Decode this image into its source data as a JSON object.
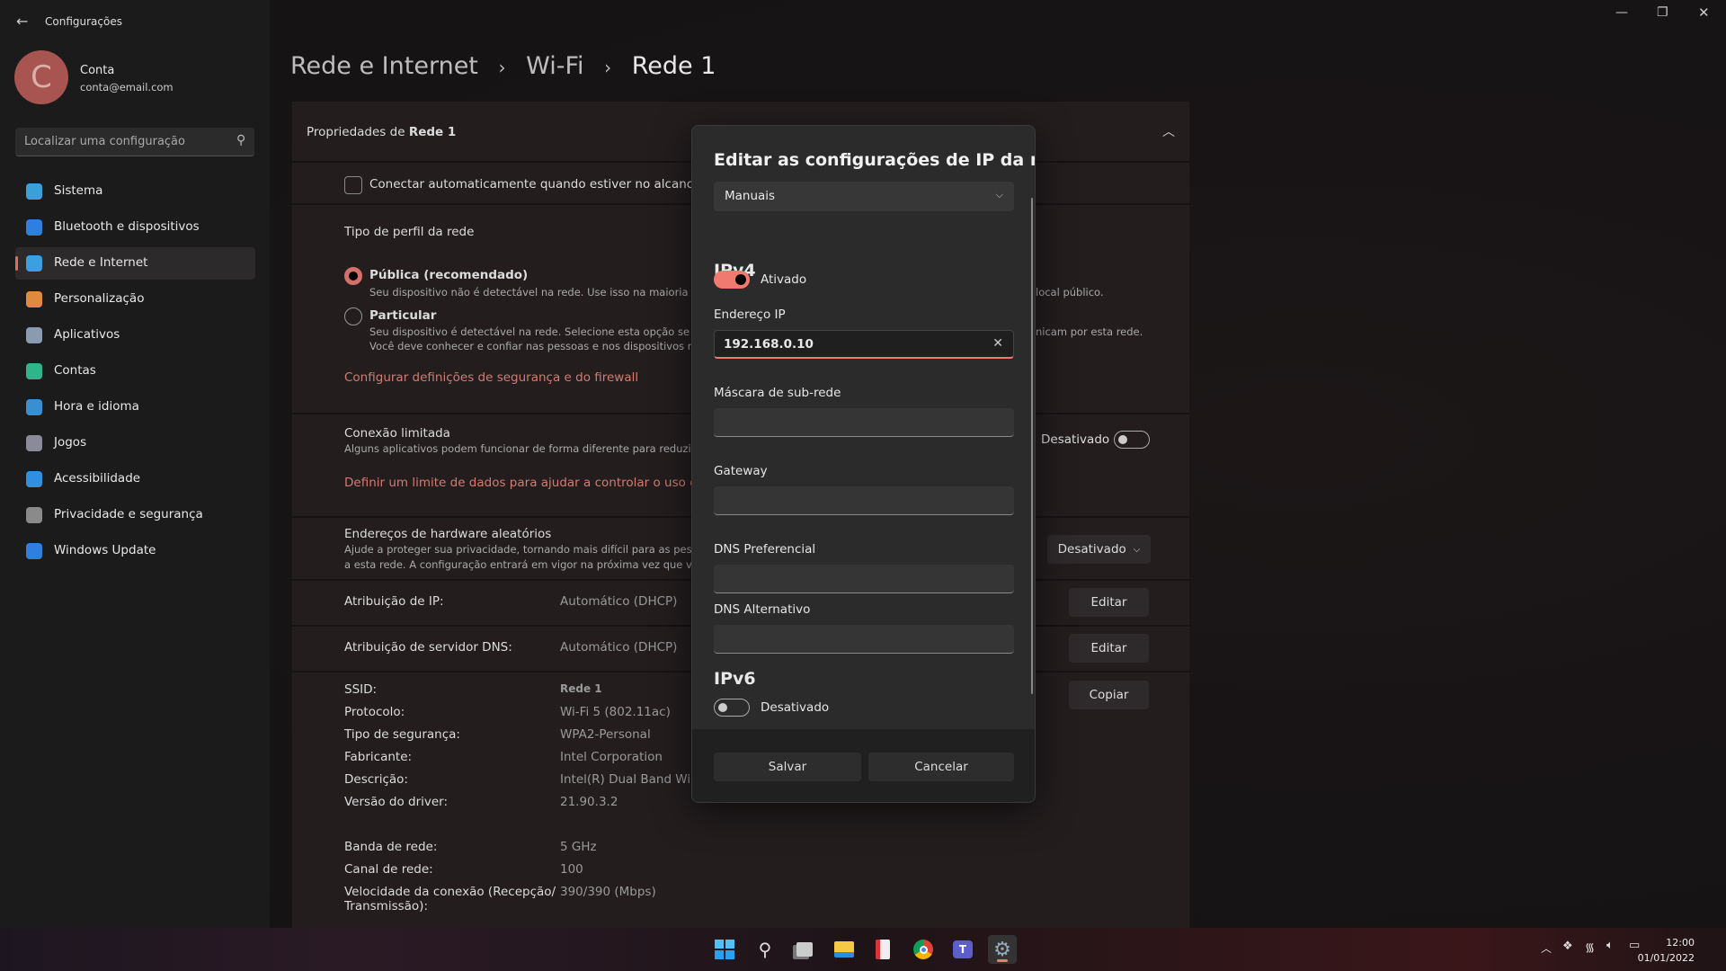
{
  "window": {
    "title": "Configurações"
  },
  "account": {
    "initial": "C",
    "name": "Conta",
    "email": "conta@email.com",
    "avatar_color": "#a85450"
  },
  "search": {
    "placeholder": "Localizar uma configuração"
  },
  "sidebar": {
    "items": [
      {
        "label": "Sistema",
        "icon": "monitor-icon",
        "color": "#3aa0d8"
      },
      {
        "label": "Bluetooth e dispositivos",
        "icon": "bluetooth-icon",
        "color": "#2f7fe0"
      },
      {
        "label": "Rede e Internet",
        "icon": "wifi-icon",
        "color": "#3aa0e0",
        "selected": true
      },
      {
        "label": "Personalização",
        "icon": "brush-icon",
        "color": "#e08a40"
      },
      {
        "label": "Aplicativos",
        "icon": "apps-icon",
        "color": "#8a9bb0"
      },
      {
        "label": "Contas",
        "icon": "person-icon",
        "color": "#2fb58a"
      },
      {
        "label": "Hora e idioma",
        "icon": "clock-globe-icon",
        "color": "#3a8fd0"
      },
      {
        "label": "Jogos",
        "icon": "gamepad-icon",
        "color": "#8a8a9a"
      },
      {
        "label": "Acessibilidade",
        "icon": "accessibility-icon",
        "color": "#2f8fe0"
      },
      {
        "label": "Privacidade e segurança",
        "icon": "shield-icon",
        "color": "#8a8a8a"
      },
      {
        "label": "Windows Update",
        "icon": "update-icon",
        "color": "#2f7fe0"
      }
    ]
  },
  "breadcrumb": [
    "Rede e Internet",
    "Wi-Fi",
    "Rede 1"
  ],
  "properties": {
    "header_prefix": "Propriedades de",
    "header_name": "Rede 1",
    "auto_connect": "Conectar automaticamente quando estiver no alcance",
    "profile_title": "Tipo de perfil da rede",
    "public_label": "Pública (recomendado)",
    "public_desc": "Seu dispositivo não é detectável na rede. Use isso na maioria dos",
    "public_desc_tail": "local público.",
    "private_label": "Particular",
    "private_desc1": "Seu dispositivo é detectável na rede. Selecione esta opção se prec",
    "private_desc1_tail": "nicam por esta rede.",
    "private_desc2": "Você deve conhecer e confiar nas pessoas e nos dispositivos na re",
    "firewall_link": "Configurar definições de segurança e do firewall",
    "metered_title": "Conexão limitada",
    "metered_desc": "Alguns aplicativos podem funcionar de forma diferente para reduzir o u",
    "metered_state": "Desativado",
    "metered_on": false,
    "data_limit_link": "Definir um limite de dados para ajudar a controlar o uso de da",
    "random_hw_title": "Endereços de hardware aleatórios",
    "random_hw_desc1": "Ajude a proteger sua privacidade, tornando mais difícil para as pessoas",
    "random_hw_desc2": "a esta rede. A configuração entrará em vigor na próxima vez que você s",
    "random_hw_value": "Desativado",
    "ip_assign_label": "Atribuição de IP:",
    "ip_assign_value": "Automático (DHCP)",
    "edit_label": "Editar",
    "dns_assign_label": "Atribuição de servidor DNS:",
    "dns_assign_value": "Automático (DHCP)",
    "copy_label": "Copiar",
    "details": [
      {
        "k": "SSID:",
        "v": "Rede 1"
      },
      {
        "k": "Protocolo:",
        "v": "Wi-Fi 5 (802.11ac)"
      },
      {
        "k": "Tipo de segurança:",
        "v": "WPA2-Personal"
      },
      {
        "k": "Fabricante:",
        "v": "Intel Corporation"
      },
      {
        "k": "Descrição:",
        "v": "Intel(R) Dual Band Wire"
      },
      {
        "k": "Versão do driver:",
        "v": "21.90.3.2"
      },
      {
        "k": "Banda de rede:",
        "v": "5 GHz"
      },
      {
        "k": "Canal de rede:",
        "v": "100"
      },
      {
        "k": "Velocidade da conexão (Recepção/",
        "k2": "Transmissão):",
        "v": "390/390 (Mbps)"
      }
    ]
  },
  "dialog": {
    "title": "Editar as configurações de IP da rede",
    "mode": "Manuais",
    "ipv4": "IPv4",
    "ipv4_state": "Ativado",
    "ipv4_on": true,
    "ip_label": "Endereço IP",
    "ip_value": "192.168.0.10",
    "mask_label": "Máscara de sub-rede",
    "mask_value": "",
    "gateway_label": "Gateway",
    "gateway_value": "",
    "dns1_label": "DNS Preferencial",
    "dns1_value": "",
    "dns2_label": "DNS Alternativo",
    "dns2_value": "",
    "ipv6": "IPv6",
    "ipv6_state": "Desativado",
    "ipv6_on": false,
    "save": "Salvar",
    "cancel": "Cancelar"
  },
  "accent": "#f07a70",
  "taskbar": {
    "icons": [
      "start-icon",
      "search-icon",
      "task-view-icon",
      "file-explorer-icon",
      "snipping-tool-icon",
      "chrome-icon",
      "teams-icon",
      "settings-icon"
    ],
    "time": "12:00",
    "date": "01/01/2022"
  }
}
